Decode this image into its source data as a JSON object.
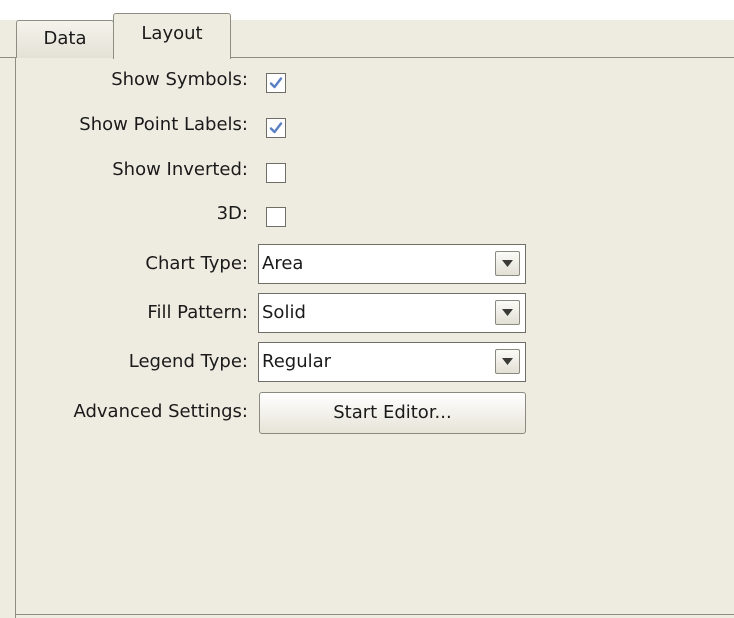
{
  "tabs": [
    {
      "label": "Data",
      "selected": false
    },
    {
      "label": "Layout",
      "selected": true
    }
  ],
  "options": {
    "show_symbols": {
      "label": "Show Symbols:",
      "checked": true
    },
    "show_point_labels": {
      "label": "Show Point Labels:",
      "checked": true
    },
    "show_inverted": {
      "label": "Show Inverted:",
      "checked": false
    },
    "three_d": {
      "label": "3D:",
      "checked": false
    }
  },
  "selects": {
    "chart_type": {
      "label": "Chart Type:",
      "value": "Area"
    },
    "fill_pattern": {
      "label": "Fill Pattern:",
      "value": "Solid"
    },
    "legend_type": {
      "label": "Legend Type:",
      "value": "Regular"
    }
  },
  "advanced": {
    "label": "Advanced Settings:",
    "button_label": "Start Editor..."
  },
  "colors": {
    "panel_background": "#eeece1",
    "border": "#8e8e80",
    "check_mark": "#5a7fc4"
  }
}
